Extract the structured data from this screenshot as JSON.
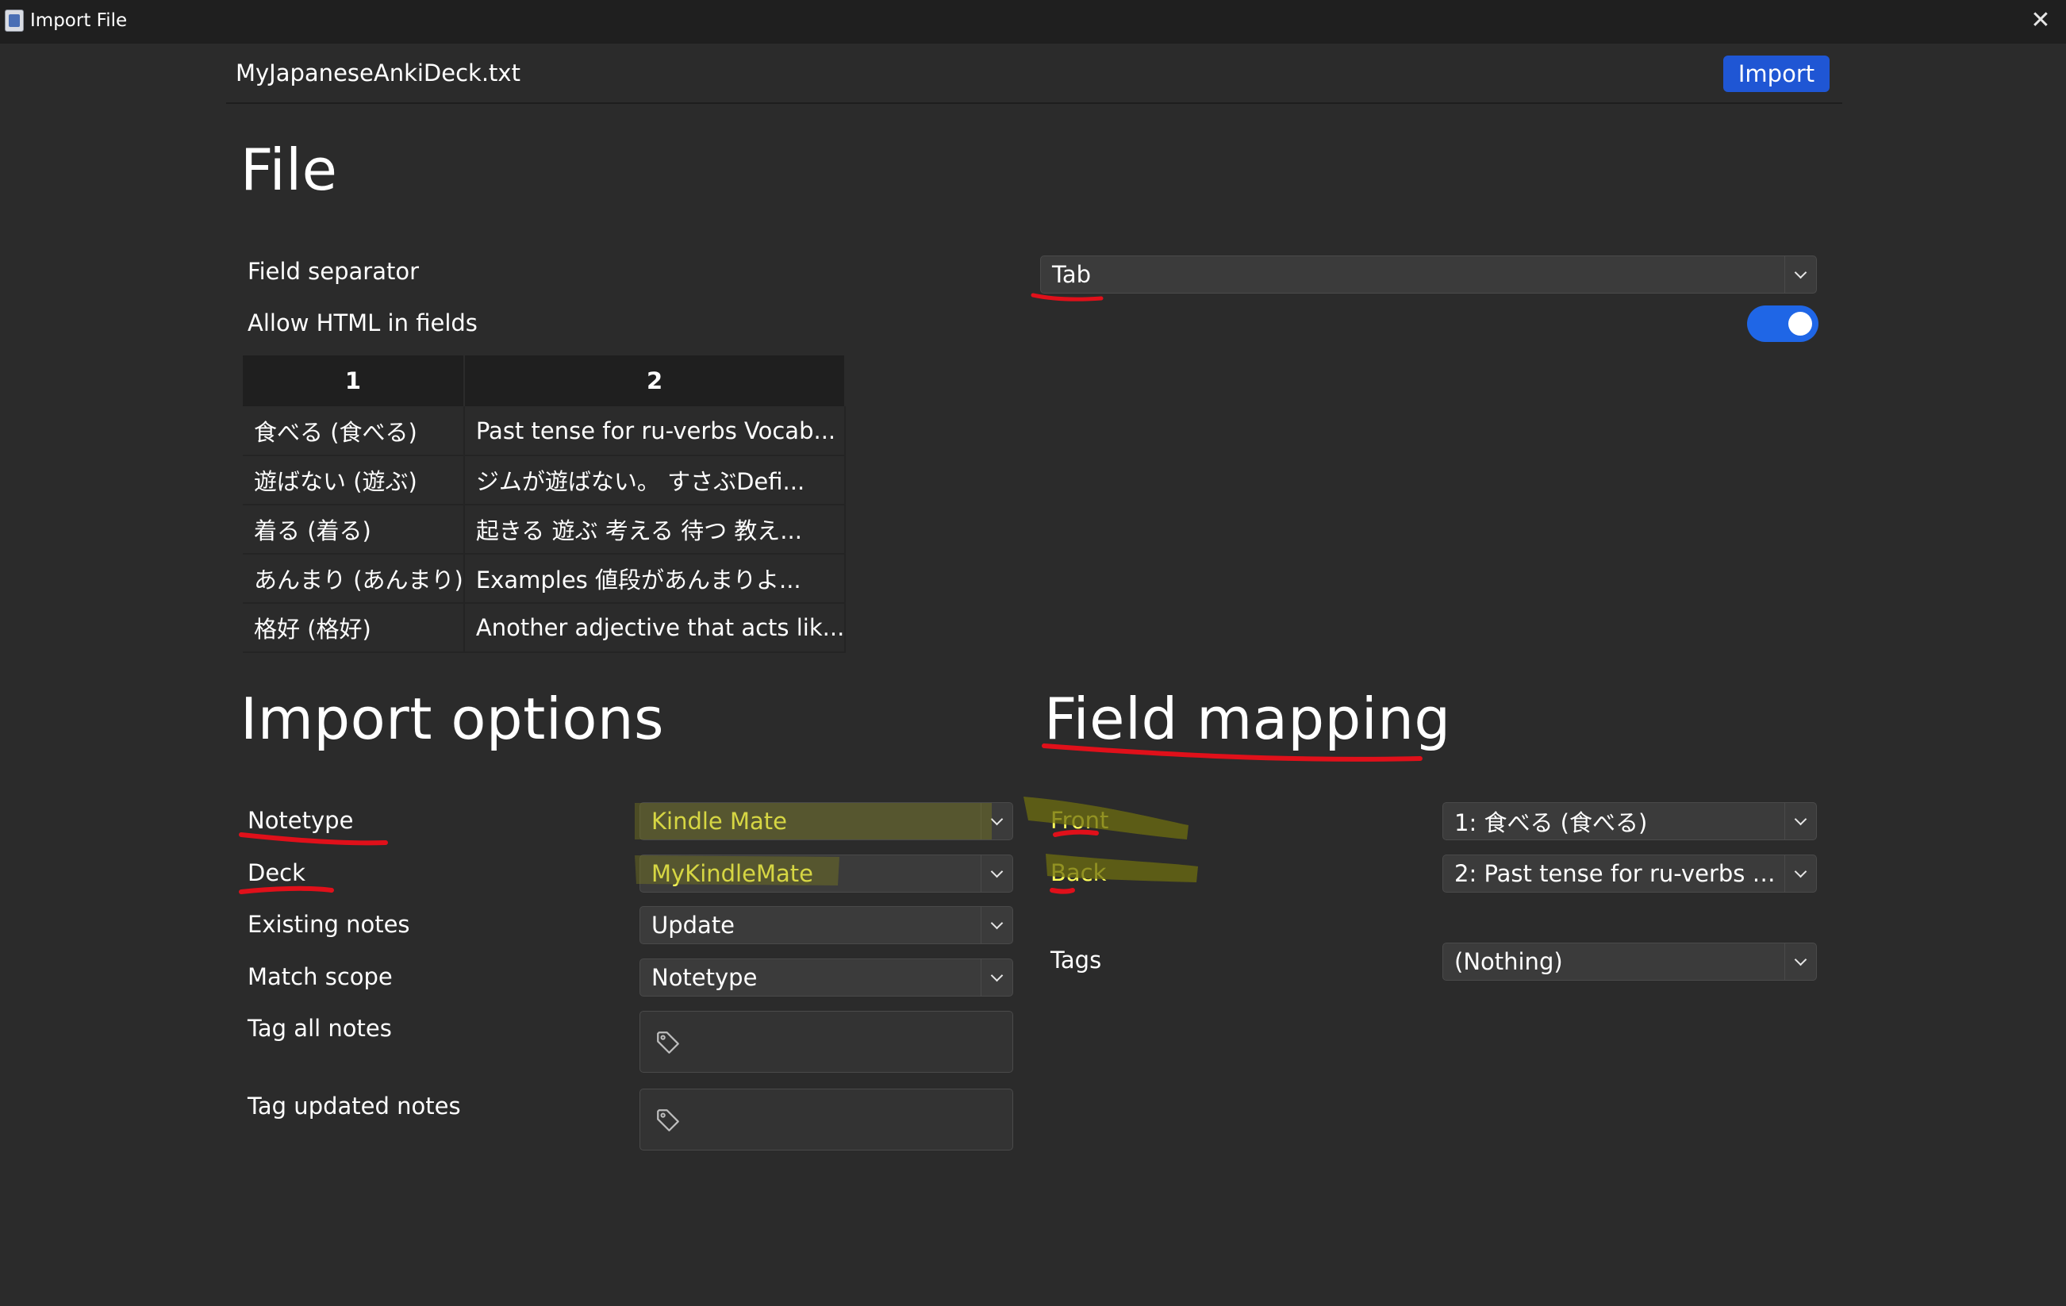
{
  "window": {
    "title": "Import File"
  },
  "header": {
    "filename": "MyJapaneseAnkiDeck.txt",
    "import_label": "Import"
  },
  "file_section": {
    "heading": "File",
    "field_separator_label": "Field separator",
    "field_separator_value": "Tab",
    "allow_html_label": "Allow HTML in fields",
    "allow_html_on": true,
    "preview": {
      "columns": [
        "1",
        "2"
      ],
      "rows": [
        [
          "食べる (食べる)",
          "Past tense for ru-verbs Vocab..."
        ],
        [
          "遊ばない (遊ぶ)",
          "ジムが遊ばない。 すさぶDefi..."
        ],
        [
          "着る (着る)",
          "起きる 遊ぶ 考える 待つ 教え..."
        ],
        [
          "あんまり (あんまり)",
          "Examples 値段があんまりよ..."
        ],
        [
          "格好 (格好)",
          "Another adjective that acts lik..."
        ]
      ]
    }
  },
  "import_options": {
    "heading": "Import options",
    "notetype_label": "Notetype",
    "notetype_value": "Kindle Mate",
    "deck_label": "Deck",
    "deck_value": "MyKindleMate",
    "existing_notes_label": "Existing notes",
    "existing_notes_value": "Update",
    "match_scope_label": "Match scope",
    "match_scope_value": "Notetype",
    "tag_all_label": "Tag all notes",
    "tag_updated_label": "Tag updated notes"
  },
  "field_mapping": {
    "heading": "Field mapping",
    "front_label": "Front",
    "front_value": "1: 食べる (食べる)",
    "back_label": "Back",
    "back_value": "2: Past tense for ru-verbs Vo...",
    "tags_label": "Tags",
    "tags_value": "(Nothing)"
  },
  "colors": {
    "background": "#2b2b2b",
    "titlebar": "#1f1f1f",
    "accent_blue": "#1f56d4",
    "highlight_yellow": "#ffff5a",
    "annotation_red": "#e0101a"
  },
  "icons": [
    "app-icon",
    "close-icon",
    "chevron-down-icon",
    "tag-icon"
  ]
}
